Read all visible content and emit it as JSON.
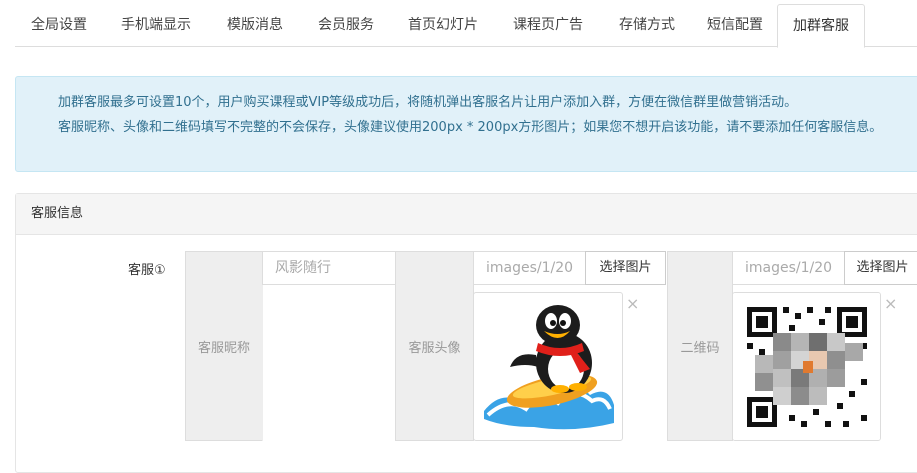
{
  "tabs": [
    {
      "label": "全局设置",
      "active": false
    },
    {
      "label": "手机端显示",
      "active": false
    },
    {
      "label": "模版消息",
      "active": false
    },
    {
      "label": "会员服务",
      "active": false
    },
    {
      "label": "首页幻灯片",
      "active": false
    },
    {
      "label": "课程页广告",
      "active": false
    },
    {
      "label": "存储方式",
      "active": false
    },
    {
      "label": "短信配置",
      "active": false
    },
    {
      "label": "加群客服",
      "active": true
    }
  ],
  "notice": {
    "line1": "加群客服最多可设置10个，用户购买课程或VIP等级成功后，将随机弹出客服名片让用户添加入群，方便在微信群里做营销活动。",
    "line2": "客服昵称、头像和二维码填写不完整的不会保存，头像建议使用200px * 200px方形图片；如果您不想开启该功能，请不要添加任何客服信息。"
  },
  "panel": {
    "heading": "客服信息",
    "row_label": "客服①",
    "nickname": {
      "addon": "客服昵称",
      "placeholder": "风影随行"
    },
    "avatar": {
      "addon": "客服头像",
      "path": "images/1/20",
      "button": "选择图片",
      "remove": "×"
    },
    "qrcode": {
      "addon": "二维码",
      "path": "images/1/20",
      "button": "选择图片",
      "remove": "×"
    }
  },
  "colors": {
    "notice_bg": "#e1f1f9",
    "notice_text": "#31708f",
    "addon_bg": "#eeeeee"
  }
}
